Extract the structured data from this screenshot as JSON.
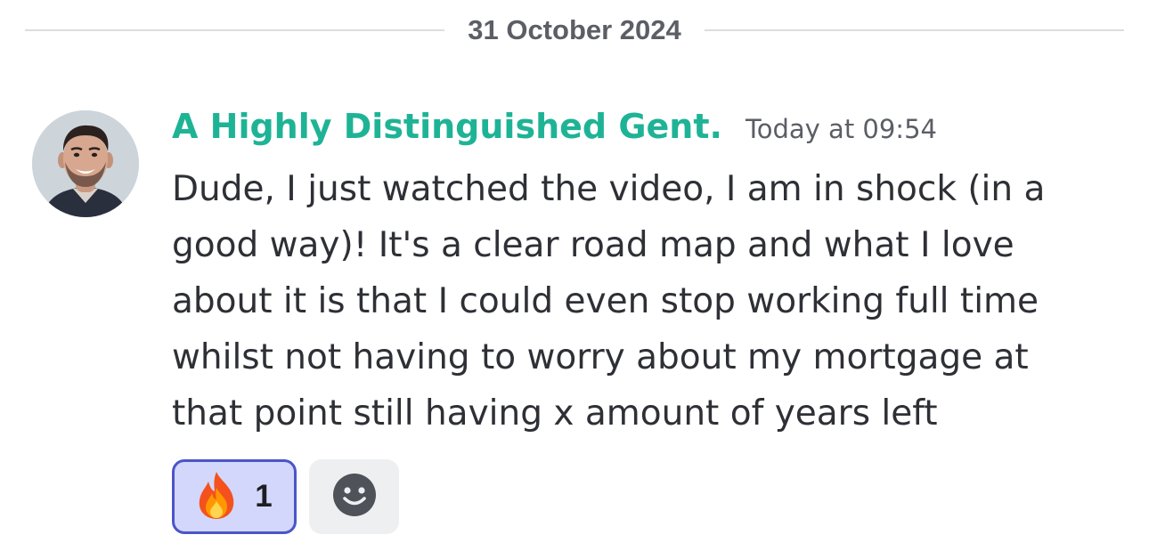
{
  "date_divider": {
    "label": "31 October 2024"
  },
  "message": {
    "author": "A Highly Distinguished Gent.",
    "author_color": "#1fb396",
    "timestamp": "Today at 09:54",
    "text": "Dude, I just watched the video, I am in shock (in a good way)! It's a clear road map and what I love about it is that I could even stop working full time whilst not having to worry about my mortgage at that point still having x amount of years left",
    "avatar_icon": "user-avatar-photo"
  },
  "reactions": [
    {
      "emoji_icon": "fire-icon",
      "count": "1",
      "active": true
    }
  ],
  "add_reaction_icon": "smiley-icon",
  "colors": {
    "reaction_active_bg": "#d3d7fb",
    "reaction_active_border": "#4b55c9",
    "add_reaction_bg": "#eeeff1",
    "text": "#2e3036",
    "muted": "#5c5e66"
  }
}
